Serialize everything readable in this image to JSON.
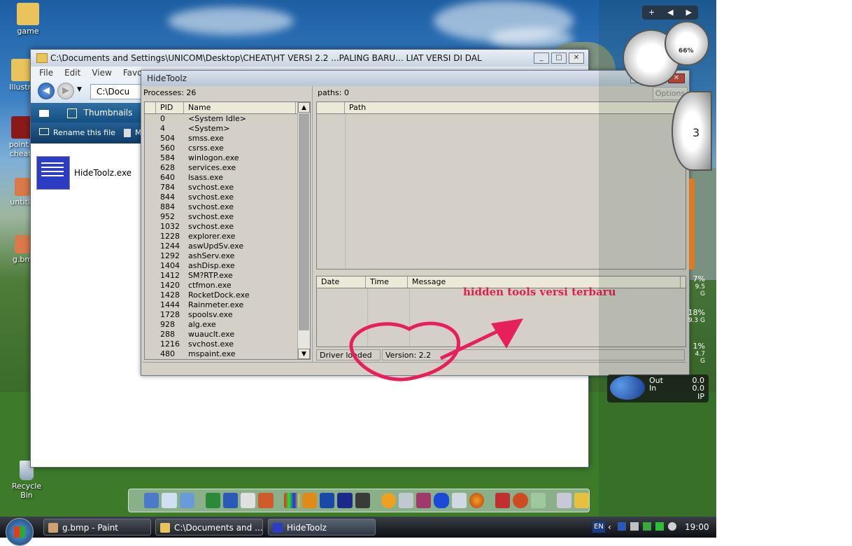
{
  "desktop": {
    "icons": [
      {
        "label": "game"
      },
      {
        "label": "Illustra"
      },
      {
        "label": "point b cheat_"
      },
      {
        "label": "untitle"
      },
      {
        "label": "g.bm"
      },
      {
        "label": "Recycle Bin"
      }
    ]
  },
  "explorer": {
    "title": "C:\\Documents and Settings\\UNICOM\\Desktop\\CHEAT\\HT VERSI 2.2 ...PALING BARU... LIAT VERSI DI DAL",
    "menu": [
      "File",
      "Edit",
      "View",
      "Favo"
    ],
    "address": "C:\\Docu",
    "views_label": "Thumbnails",
    "task_rename": "Rename this file",
    "task_move": "Mov",
    "file_name": "HideToolz.exe"
  },
  "hidetoolz": {
    "title": "HideToolz",
    "processes_label": "Processes: 26",
    "paths_label": "paths: 0",
    "options_label": "Options",
    "process_columns": [
      "PID",
      "Name"
    ],
    "path_columns": [
      "Path"
    ],
    "log_columns": [
      "Date",
      "Time",
      "Message"
    ],
    "processes": [
      {
        "pid": "0",
        "name": "<System Idle>"
      },
      {
        "pid": "4",
        "name": "<System>"
      },
      {
        "pid": "504",
        "name": "smss.exe"
      },
      {
        "pid": "560",
        "name": "csrss.exe"
      },
      {
        "pid": "584",
        "name": "winlogon.exe"
      },
      {
        "pid": "628",
        "name": "services.exe"
      },
      {
        "pid": "640",
        "name": "lsass.exe"
      },
      {
        "pid": "784",
        "name": "svchost.exe"
      },
      {
        "pid": "844",
        "name": "svchost.exe"
      },
      {
        "pid": "884",
        "name": "svchost.exe"
      },
      {
        "pid": "952",
        "name": "svchost.exe"
      },
      {
        "pid": "1032",
        "name": "svchost.exe"
      },
      {
        "pid": "1228",
        "name": "explorer.exe"
      },
      {
        "pid": "1244",
        "name": "aswUpdSv.exe"
      },
      {
        "pid": "1292",
        "name": "ashServ.exe"
      },
      {
        "pid": "1404",
        "name": "ashDisp.exe"
      },
      {
        "pid": "1412",
        "name": "SM?RTP.exe"
      },
      {
        "pid": "1420",
        "name": "ctfmon.exe"
      },
      {
        "pid": "1428",
        "name": "RocketDock.exe"
      },
      {
        "pid": "1444",
        "name": "Rainmeter.exe"
      },
      {
        "pid": "1728",
        "name": "spoolsv.exe"
      },
      {
        "pid": "928",
        "name": "alg.exe"
      },
      {
        "pid": "288",
        "name": "wuauclt.exe"
      },
      {
        "pid": "1216",
        "name": "svchost.exe"
      },
      {
        "pid": "480",
        "name": "mspaint.exe"
      }
    ],
    "status_driver": "Driver loaded",
    "status_version": "Version: 2.2"
  },
  "annotation": {
    "text": "hidden tools versi terbaru",
    "color": "#e0204a"
  },
  "gadgets": {
    "cpu_percent": "66%",
    "clock_digit": "3",
    "meters": [
      {
        "pct": "7%",
        "val": "9.5 G"
      },
      {
        "pct": "18%",
        "val": "9.3 G"
      },
      {
        "pct": "1%",
        "val": "4.7 G"
      }
    ],
    "net_out_label": "Out",
    "net_in_label": "In",
    "net_out_value": "0.0",
    "net_in_value": "0.0",
    "net_ip": "IP"
  },
  "taskbar": {
    "tasks": [
      {
        "label": "g.bmp - Paint"
      },
      {
        "label": "C:\\Documents and ..."
      },
      {
        "label": "HideToolz"
      }
    ],
    "lang": "EN",
    "time": "19:00"
  }
}
